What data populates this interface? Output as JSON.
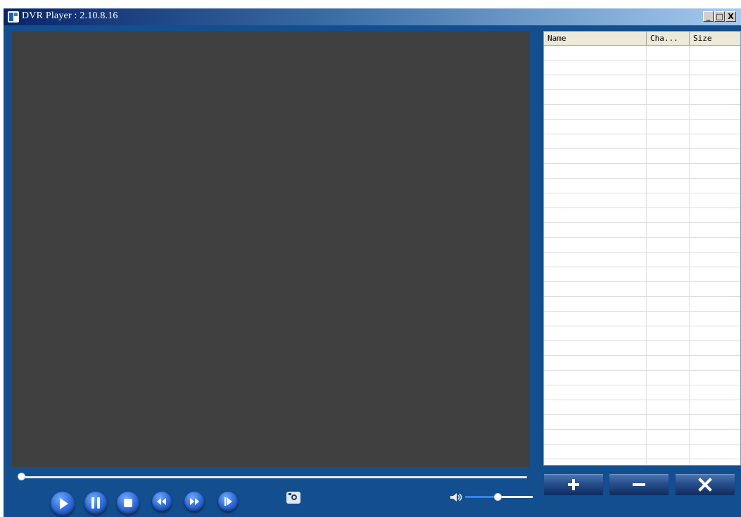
{
  "window": {
    "title": "DVR Player : 2.10.8.16",
    "minimize_label": "_",
    "maximize_label": "□",
    "close_label": "X"
  },
  "filelist": {
    "columns": [
      "Name",
      "Cha...",
      "Size"
    ],
    "rows": []
  },
  "player": {
    "controls": [
      "play",
      "pause",
      "stop",
      "rewind",
      "fast-forward",
      "next-frame"
    ],
    "seek_position": 0,
    "volume_level": 0.45
  },
  "list_buttons": {
    "add_icon": "plus-icon",
    "remove_icon": "minus-icon",
    "clear_icon": "x-icon"
  },
  "colors": {
    "background": "#134e8e",
    "video_area": "#404040",
    "accent": "#2f89e6"
  }
}
